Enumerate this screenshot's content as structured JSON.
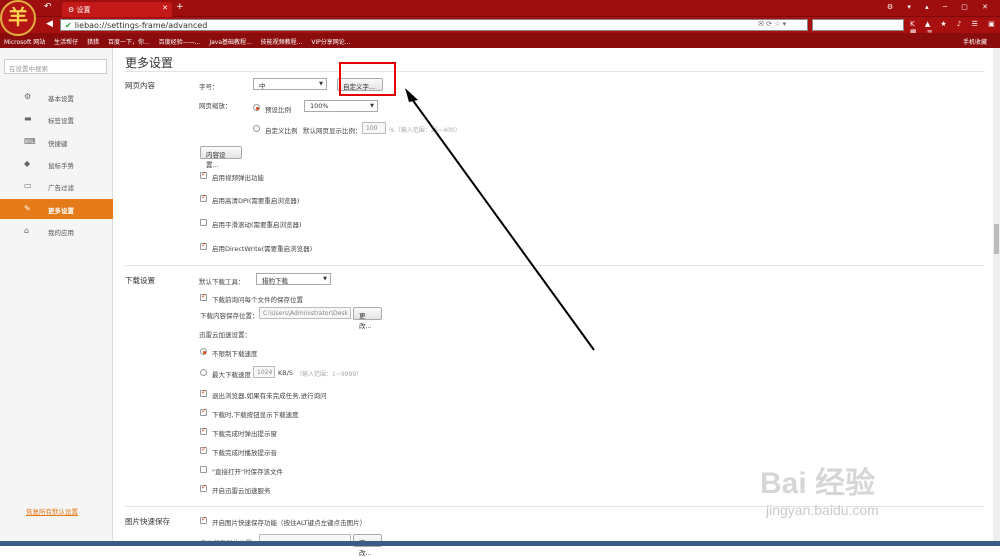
{
  "browser": {
    "logo_char": "羊",
    "tab_title": "设置",
    "url": "liebao://settings-frame/advanced"
  },
  "bookmarks": [
    "Microsoft 网站",
    "生活帮仔",
    "猎猎",
    "百度一下，你...",
    "百度经验——...",
    "Java基础教程...",
    "技能视频教程...",
    "VIP分享网论..."
  ],
  "bookmarks_right": "手机收藏",
  "sidebar": {
    "search_placeholder": "在设置中搜索",
    "items": [
      {
        "icon": "gear-icon",
        "label": "基本设置"
      },
      {
        "icon": "tag-icon",
        "label": "标签设置"
      },
      {
        "icon": "keyboard-icon",
        "label": "快捷键"
      },
      {
        "icon": "shield-icon",
        "label": "鼠标手势"
      },
      {
        "icon": "filter-icon",
        "label": "广告过滤"
      },
      {
        "icon": "wrench-icon",
        "label": "更多设置",
        "active": true
      },
      {
        "icon": "home-icon",
        "label": "我的应用"
      }
    ],
    "restore_defaults": "恢复所有默认设置"
  },
  "main": {
    "title": "更多设置",
    "web": {
      "heading": "网页内容",
      "font_label": "字号：",
      "font_value": "中",
      "custom_font_btn": "自定义字...",
      "zoom_label": "网页缩放：",
      "preset_label": "预设比例",
      "preset_value": "100%",
      "custom_label": "自定义比例",
      "default_display": "默认网页显示比例：",
      "custom_value": "100",
      "custom_hint": "%（输入范围：25~400）",
      "content_settings_btn": "内容设置...",
      "options": [
        "启用视频弹出功能",
        "启用高清DPI(需要重启浏览器)",
        "启用平滑滚动(需要重启浏览器)",
        "启用DirectWrite(需要重启浏览器)"
      ],
      "options_checked": [
        true,
        true,
        false,
        true
      ]
    },
    "download": {
      "heading": "下载设置",
      "tool_label": "默认下载工具：",
      "tool_value": "猎豹下载",
      "ask_path": "下载前询问每个文件的保存位置",
      "path_label": "下载内容保存位置：",
      "path_value": "C:\\Users\\Administrator\\Desk",
      "change_btn": "更改...",
      "xunlei_label": "迅雷云加速设置：",
      "unlimited": "不限制下载速度",
      "max_speed_label": "最大下载速度",
      "max_speed_value": "1024",
      "max_speed_unit": "KB/S",
      "max_speed_hint": "（输入范围：1~9999）",
      "options": [
        "退出浏览器,如果有未完成任务,进行询问",
        "下载时,下载按钮显示下载速度",
        "下载完成时弹出提示窗",
        "下载完成时播放提示音",
        "\"直接打开\"时保存该文件",
        "开启迅雷云加速服务"
      ],
      "options_checked": [
        true,
        true,
        true,
        true,
        false,
        true
      ]
    },
    "image": {
      "heading": "图片快速保存",
      "option": "开启图片快速保存功能（按住ALT键点左键点击图片）",
      "path_label": "自动保存到此位置：",
      "change_btn": "更改..."
    }
  },
  "watermark": {
    "main": "Bai 经验",
    "sub": "jingyan.baidu.com"
  }
}
